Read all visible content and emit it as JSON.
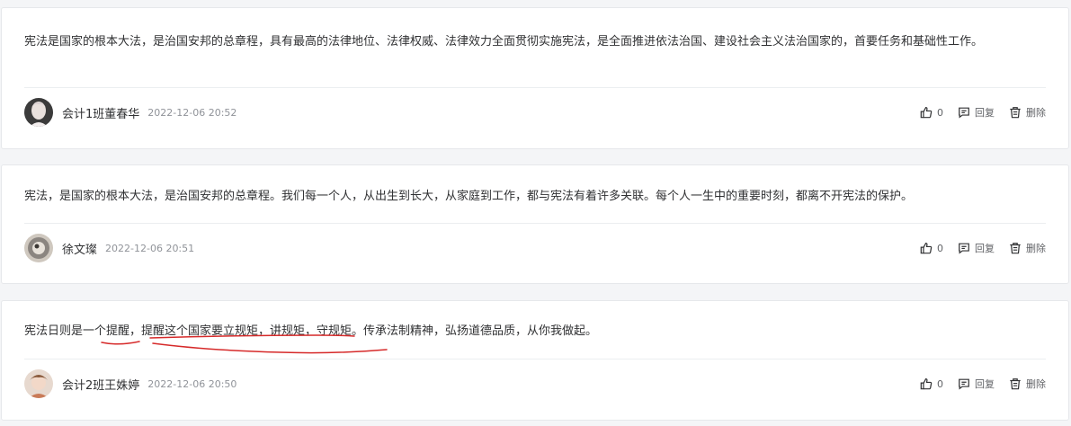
{
  "comments": [
    {
      "content": "宪法是国家的根本大法，是治国安邦的总章程，具有最高的法律地位、法律权威、法律效力全面贯彻实施宪法，是全面推进依法治国、建设社会主义法治国家的，首要任务和基础性工作。",
      "author": "会计1班董春华",
      "time": "2022-12-06 20:52",
      "likes": "0",
      "reply_label": "回复",
      "delete_label": "删除"
    },
    {
      "content": "宪法，是国家的根本大法，是治国安邦的总章程。我们每一个人，从出生到长大，从家庭到工作，都与宪法有着许多关联。每个人一生中的重要时刻，都离不开宪法的保护。",
      "author": "徐文璨",
      "time": "2022-12-06 20:51",
      "likes": "0",
      "reply_label": "回复",
      "delete_label": "删除"
    },
    {
      "content": "宪法日则是一个提醒，提醒这个国家要立规矩，讲规矩，守规矩。传承法制精神，弘扬道德品质，从你我做起。",
      "author": "会计2班王姝婷",
      "time": "2022-12-06 20:50",
      "likes": "0",
      "reply_label": "回复",
      "delete_label": "删除"
    }
  ],
  "colors": {
    "background": "#f4f5f7",
    "card": "#ffffff",
    "text": "#303133",
    "muted": "#909399",
    "annotation": "#d62a2a"
  },
  "icons": [
    "thumbs-up-icon",
    "reply-icon",
    "trash-icon"
  ]
}
